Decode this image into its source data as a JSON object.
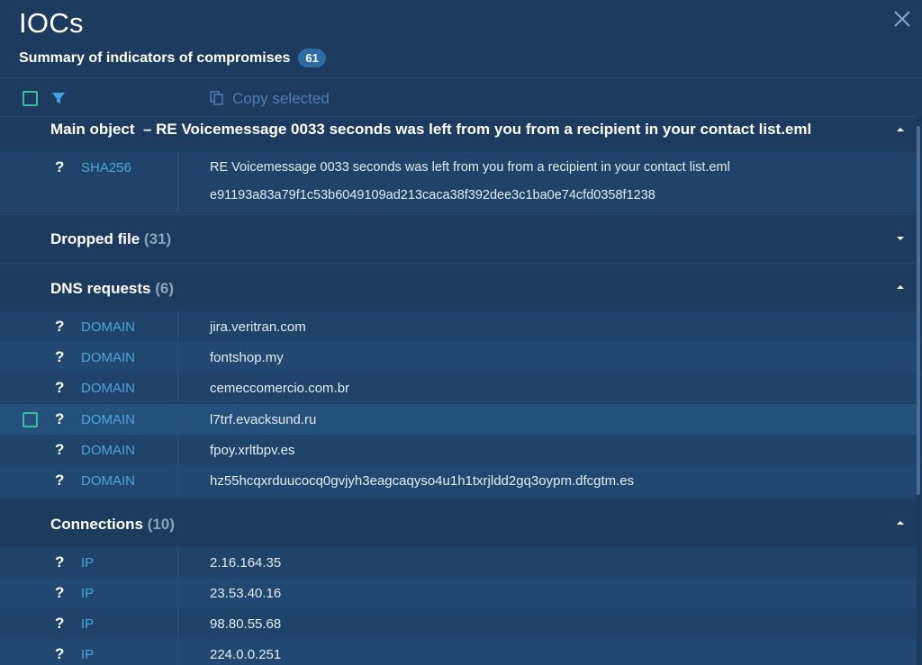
{
  "header": {
    "title": "IOCs",
    "subtitle": "Summary of indicators of compromises",
    "count": "61"
  },
  "toolbar": {
    "copy_label": "Copy selected"
  },
  "main_object": {
    "title": "Main object  – RE Voicemessage 0033 seconds was left from you from a recipient in your contact list.eml",
    "rows": [
      {
        "type": "SHA256",
        "name": "RE Voicemessage 0033 seconds was left from you from a recipient in your contact list.eml",
        "hash": "e91193a83a79f1c53b6049109ad213caca38f392dee3c1ba0e74cfd0358f1238"
      }
    ]
  },
  "dropped": {
    "title": "Dropped file",
    "count": "(31)"
  },
  "dns": {
    "title": "DNS requests",
    "count": "(6)",
    "rows": [
      {
        "type": "DOMAIN",
        "value": "jira.veritran.com"
      },
      {
        "type": "DOMAIN",
        "value": "fontshop.my"
      },
      {
        "type": "DOMAIN",
        "value": "cemeccomercio.com.br"
      },
      {
        "type": "DOMAIN",
        "value": "l7trf.evacksund.ru"
      },
      {
        "type": "DOMAIN",
        "value": "fpoy.xrltbpv.es"
      },
      {
        "type": "DOMAIN",
        "value": "hz55hcqxrduucocq0gvjyh3eagcaqyso4u1h1txrjldd2gq3oypm.dfcgtm.es"
      }
    ]
  },
  "connections": {
    "title": "Connections",
    "count": "(10)",
    "rows": [
      {
        "type": "IP",
        "value": "2.16.164.35"
      },
      {
        "type": "IP",
        "value": "23.53.40.16"
      },
      {
        "type": "IP",
        "value": "98.80.55.68"
      },
      {
        "type": "IP",
        "value": "224.0.0.251"
      }
    ]
  },
  "unknown_mark": "?",
  "colors": {
    "accent": "#3fb8a4",
    "link": "#4ea3dc",
    "background": "#1b3a5c"
  }
}
